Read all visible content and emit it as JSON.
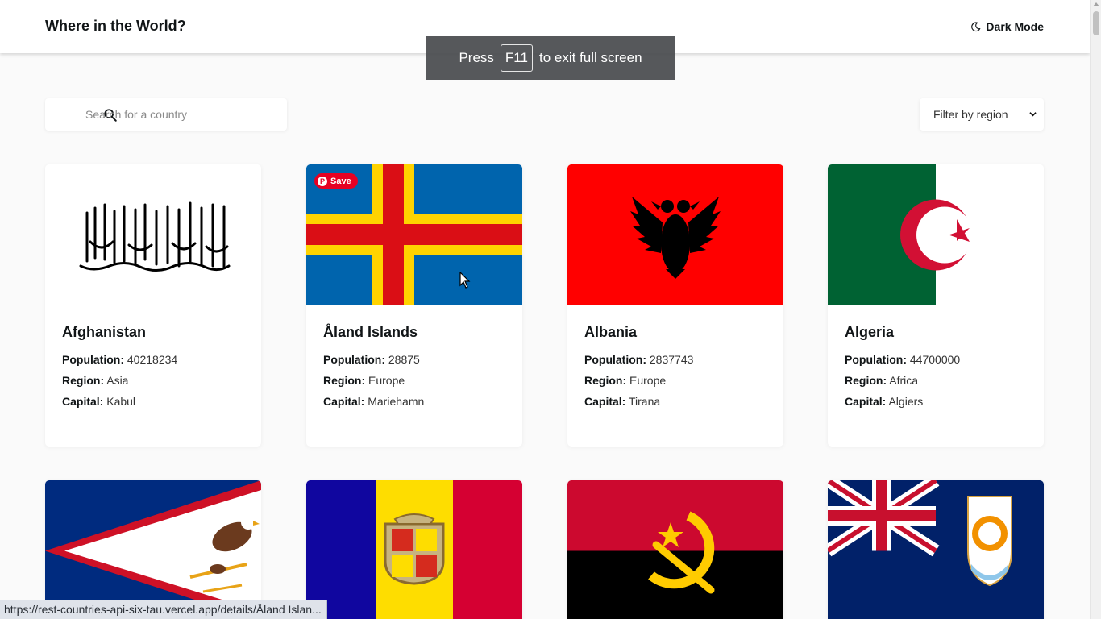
{
  "header": {
    "title": "Where in the World?",
    "dark_mode_label": "Dark Mode"
  },
  "fullscreen_toast": {
    "prefix": "Press",
    "key": "F11",
    "suffix": "to exit full screen"
  },
  "search": {
    "placeholder": "Search for a country",
    "value": ""
  },
  "filter": {
    "selected": "Filter by region"
  },
  "labels": {
    "population": "Population:",
    "region": "Region:",
    "capital": "Capital:"
  },
  "pin_save": {
    "label": "Save"
  },
  "countries": [
    {
      "name": "Afghanistan",
      "population": "40218234",
      "region": "Asia",
      "capital": "Kabul"
    },
    {
      "name": "Åland Islands",
      "population": "28875",
      "region": "Europe",
      "capital": "Mariehamn"
    },
    {
      "name": "Albania",
      "population": "2837743",
      "region": "Europe",
      "capital": "Tirana"
    },
    {
      "name": "Algeria",
      "population": "44700000",
      "region": "Africa",
      "capital": "Algiers"
    }
  ],
  "status_url": "https://rest-countries-api-six-tau.vercel.app/details/Åland Islan...",
  "colors": {
    "accent_red": "#e60023",
    "background": "#fafafa"
  }
}
